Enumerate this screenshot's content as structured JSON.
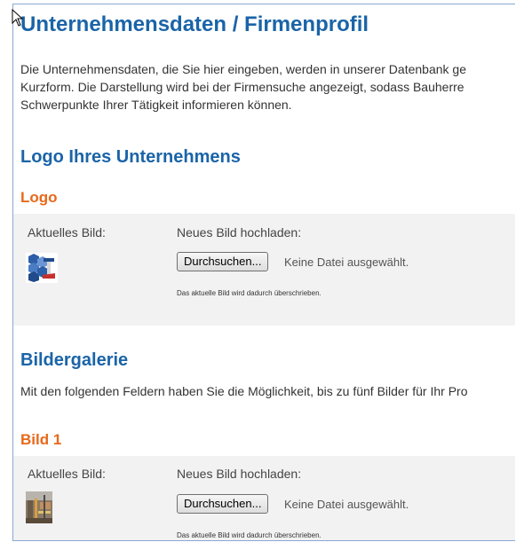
{
  "page": {
    "title": "Unternehmensdaten / Firmenprofil",
    "intro_lines": [
      "Die Unternehmensdaten, die Sie hier eingeben, werden in unserer Datenbank ge",
      "Kurzform. Die Darstellung wird bei der Firmensuche angezeigt, sodass Bauherre",
      "Schwerpunkte Ihrer Tätigkeit informieren können."
    ]
  },
  "logo_section": {
    "heading": "Logo Ihres Unternehmens",
    "subheading": "Logo",
    "current_label": "Aktuelles Bild:",
    "upload_label": "Neues Bild hochladen:",
    "browse_button": "Durchsuchen...",
    "no_file_text": "Keine Datei ausgewählt.",
    "note": "Das aktuelle Bild wird dadurch überschrieben."
  },
  "gallery_section": {
    "heading": "Bildergalerie",
    "intro": "Mit den folgenden Feldern haben Sie die Möglichkeit, bis zu fünf Bilder für Ihr Pro",
    "subheading": "Bild 1",
    "current_label": "Aktuelles Bild:",
    "upload_label": "Neues Bild hochladen:",
    "browse_button": "Durchsuchen...",
    "no_file_text": "Keine Datei ausgewählt.",
    "note": "Das aktuelle Bild wird dadurch überschrieben."
  },
  "colors": {
    "heading_blue": "#1a64a8",
    "subheading_orange": "#e8681a",
    "panel_gray": "#f2f2f2"
  }
}
